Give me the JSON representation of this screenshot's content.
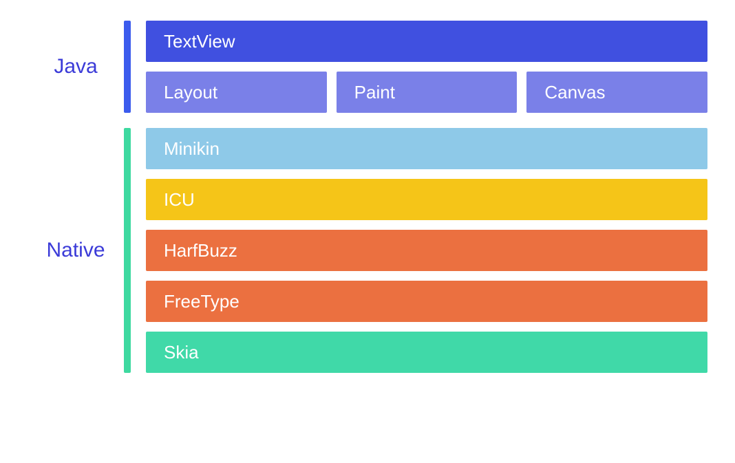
{
  "sections": {
    "java": {
      "label": "Java",
      "rows": {
        "textview": "TextView",
        "layout": "Layout",
        "paint": "Paint",
        "canvas": "Canvas"
      }
    },
    "native": {
      "label": "Native",
      "rows": {
        "minikin": "Minikin",
        "icu": "ICU",
        "harfbuzz": "HarfBuzz",
        "freetype": "FreeType",
        "skia": "Skia"
      }
    }
  },
  "colors": {
    "label_text": "#3b3bd8",
    "java_bar": "#3b5bed",
    "native_bar": "#3ed9a0",
    "textview": "#4050e0",
    "layout_paint_canvas": "#7a80e8",
    "minikin": "#8ec9e8",
    "icu": "#f5c518",
    "harfbuzz_freetype": "#eb7040",
    "skia": "#40d9a8"
  }
}
